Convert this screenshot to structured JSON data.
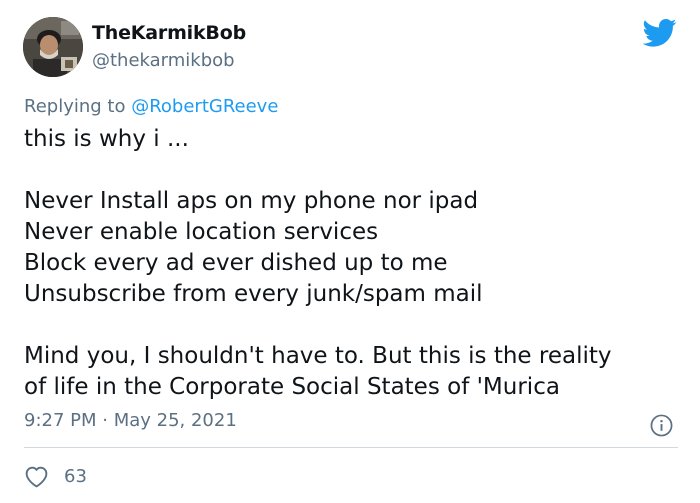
{
  "author": {
    "display_name": "TheKarmikBob",
    "handle": "@thekarmikbob",
    "avatar_icon": "user-avatar-photo"
  },
  "brand": {
    "icon": "twitter-bird-icon",
    "color": "#1d9bf0"
  },
  "reply": {
    "prefix": "Replying to",
    "mention": "@RobertGReeve"
  },
  "tweet": {
    "paragraphs": [
      [
        "this is why i ..."
      ],
      [
        "Never Install aps on my phone nor ipad",
        "Never enable location services",
        "Block every ad ever dished up to me",
        "Unsubscribe from every junk/spam mail"
      ],
      [
        "Mind you, I shouldn't have to. But this is the reality",
        "of life in the Corporate Social States of 'Murica"
      ]
    ]
  },
  "meta": {
    "timestamp": "9:27 PM · May 25, 2021",
    "info_icon": "info-icon"
  },
  "actions": {
    "like_icon": "heart-icon",
    "like_count": "63"
  },
  "colors": {
    "text": "#0f1419",
    "secondary": "#5b7083",
    "link": "#1d9bf0",
    "divider": "#cfd9de"
  }
}
